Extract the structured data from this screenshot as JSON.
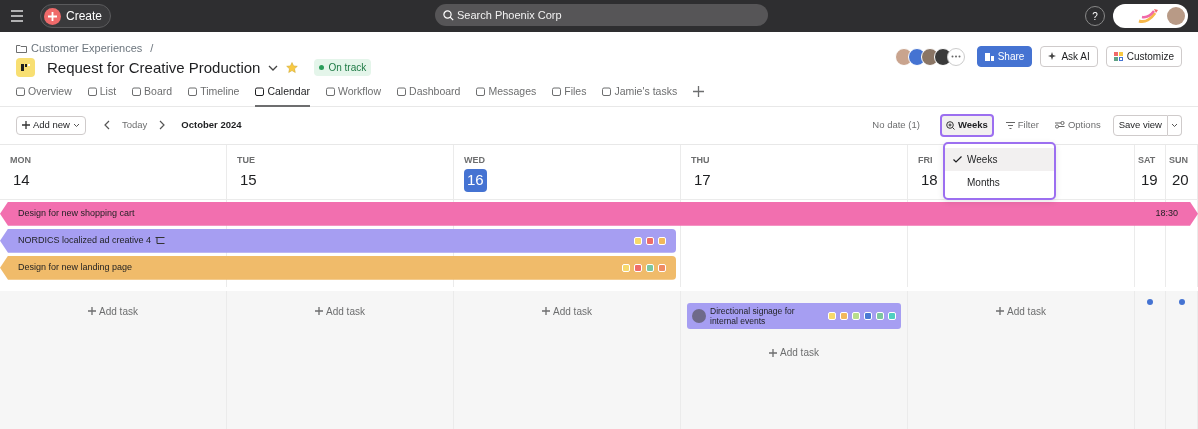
{
  "topbar": {
    "create": "Create",
    "search_placeholder": "Search Phoenix Corp",
    "help": "?"
  },
  "breadcrumb": "Customer Experiences",
  "breadcrumb_sep": "/",
  "project": {
    "title": "Request for Creative Production",
    "status": "On track",
    "starred": true
  },
  "header_buttons": [
    {
      "label": "Share",
      "kind": "primary"
    },
    {
      "label": "Ask AI",
      "kind": "ai"
    },
    {
      "label": "Customize",
      "kind": "customize"
    }
  ],
  "tabs": [
    {
      "label": "Overview",
      "selected": false
    },
    {
      "label": "List",
      "selected": false
    },
    {
      "label": "Board",
      "selected": false
    },
    {
      "label": "Timeline",
      "selected": false
    },
    {
      "label": "Calendar",
      "selected": true
    },
    {
      "label": "Workflow",
      "selected": false
    },
    {
      "label": "Dashboard",
      "selected": false
    },
    {
      "label": "Messages",
      "selected": false
    },
    {
      "label": "Files",
      "selected": false
    },
    {
      "label": "Jamie's tasks",
      "selected": false
    }
  ],
  "toolbar": {
    "add_new": "Add new",
    "today": "Today",
    "month": "October 2024",
    "no_date": "No date (1)",
    "view": "Weeks",
    "filter": "Filter",
    "options": "Options",
    "save_view": "Save view"
  },
  "view_menu": [
    {
      "label": "Weeks",
      "selected": true
    },
    {
      "label": "Months",
      "selected": false
    }
  ],
  "spanning_tasks": [
    {
      "title": "Design for new shopping cart",
      "color": "#f26faf",
      "spans_week": true,
      "continues_after": true,
      "time": "18:30",
      "subtasks": false
    },
    {
      "title": "NORDICS localized ad creative 4",
      "color": "#a69ef2",
      "spans_week": false,
      "continues_after": false,
      "subtasks": true,
      "tags": [
        {
          "color": "#f7d96b"
        },
        {
          "color": "#ee6d68"
        },
        {
          "color": "#f2b85a"
        }
      ]
    },
    {
      "title": "Design for new landing page",
      "color": "#f0bb6a",
      "spans_week": false,
      "continues_after": false,
      "subtasks": false,
      "tags": [
        {
          "color": "#f7d96b"
        },
        {
          "color": "#ee6d68"
        },
        {
          "color": "#7dc6a0"
        },
        {
          "color": "#ef8c63"
        }
      ]
    }
  ],
  "days": [
    {
      "name": "MON",
      "date": "14",
      "today": false,
      "narrow": false,
      "add_task": "Add task",
      "dot": false
    },
    {
      "name": "TUE",
      "date": "15",
      "today": false,
      "narrow": false,
      "add_task": "Add task",
      "dot": false
    },
    {
      "name": "WED",
      "date": "16",
      "today": true,
      "narrow": false,
      "add_task": "Add task",
      "dot": false
    },
    {
      "name": "THU",
      "date": "17",
      "today": false,
      "narrow": false,
      "add_task": "Add task",
      "dot": false,
      "tasks": [
        {
          "title": "Directional signage for internal events",
          "color": "#a69ef2",
          "tags": [
            {
              "color": "#f7d96b"
            },
            {
              "color": "#f2b85a"
            },
            {
              "color": "#b8dd8c"
            },
            {
              "color": "#4a7bd4"
            },
            {
              "color": "#7dc6a0"
            },
            {
              "color": "#4fcfc0"
            }
          ]
        }
      ]
    },
    {
      "name": "FRI",
      "date": "18",
      "today": false,
      "narrow": false,
      "add_task": "Add task",
      "dot": false
    },
    {
      "name": "SAT",
      "date": "19",
      "today": false,
      "narrow": true,
      "dot": true
    },
    {
      "name": "SUN",
      "date": "20",
      "today": false,
      "narrow": true,
      "dot": true
    }
  ]
}
